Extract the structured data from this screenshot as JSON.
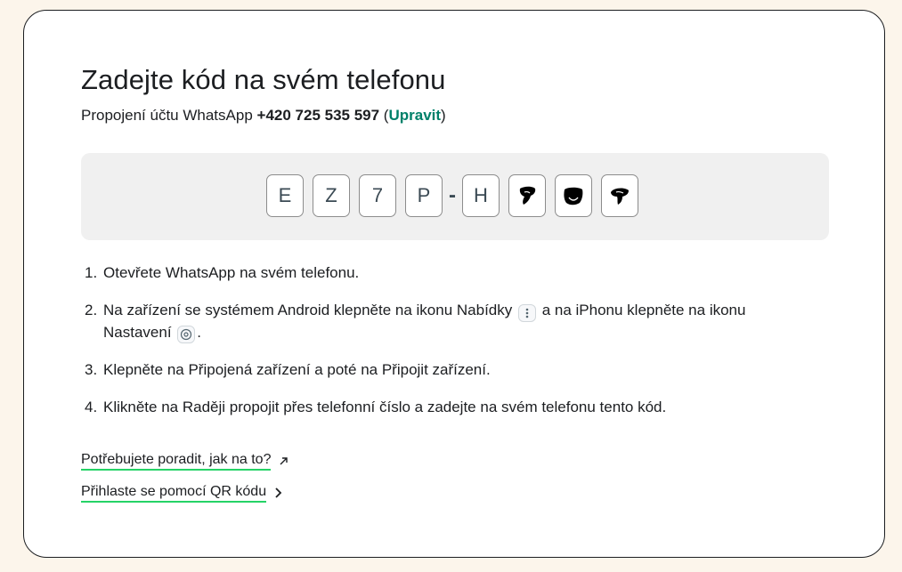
{
  "title": "Zadejte kód na svém telefonu",
  "subtitle": {
    "prefix": "Propojení účtu WhatsApp ",
    "phone": "+420 725 535 597",
    "open_paren": " (",
    "edit_label": "Upravit",
    "close_paren": ")"
  },
  "code": {
    "characters": [
      "E",
      "Z",
      "7",
      "P",
      "H",
      "",
      "",
      ""
    ],
    "separator": "-",
    "redacted_count": 3
  },
  "steps": [
    {
      "number": "1.",
      "text": "Otevřete WhatsApp na svém telefonu."
    },
    {
      "number": "2.",
      "text_a": "Na zařízení se systémem Android klepněte na ikonu Nabídky",
      "text_b": "a na iPhonu klepněte na ikonu Nastavení",
      "text_c": "."
    },
    {
      "number": "3.",
      "text": "Klepněte na Připojená zařízení a poté na Připojit zařízení."
    },
    {
      "number": "4.",
      "text": "Klikněte na Raději propojit přes telefonní číslo a zadejte na svém telefonu tento kód."
    }
  ],
  "links": {
    "help": "Potřebujete poradit, jak na to?",
    "qr": "Přihlaste se pomocí QR kódu"
  },
  "colors": {
    "background": "#fcf5eb",
    "accent": "#008069",
    "link_underline": "#25d366"
  }
}
